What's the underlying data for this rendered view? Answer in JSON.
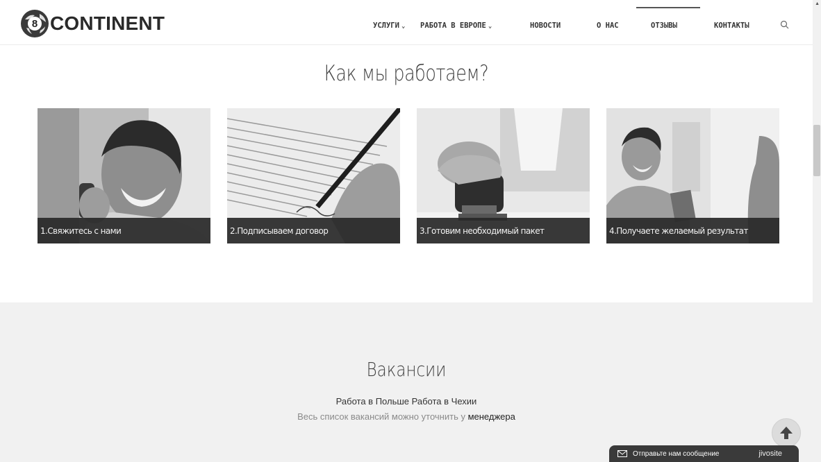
{
  "header": {
    "logo_digit": "8",
    "logo_text": "CONTINENT",
    "nav": [
      {
        "label": "УСЛУГИ",
        "dropdown": true
      },
      {
        "label": "РАБОТА В ЕВРОПЕ",
        "dropdown": true
      },
      {
        "label": "НОВОСТИ",
        "dropdown": false
      },
      {
        "label": "О НАС",
        "dropdown": false
      },
      {
        "label": "ОТЗЫВЫ",
        "dropdown": false,
        "active": true
      },
      {
        "label": "КОНТАКТЫ",
        "dropdown": false
      }
    ],
    "chevron": "⌄"
  },
  "how": {
    "title": "Как мы работаем?",
    "steps": [
      {
        "caption": "1.Свяжитесь с нами",
        "image": "smiling man on phone"
      },
      {
        "caption": "2.Подписываем договор",
        "image": "hand signing document"
      },
      {
        "caption": "3.Готовим необходимый пакет",
        "image": "hand with stamp"
      },
      {
        "caption": "4.Получаете желаемый результат",
        "image": "smiling man with passport"
      }
    ]
  },
  "vacancies": {
    "title": "Вакансии",
    "link_poland": "Работа в Польше",
    "link_czech": "Работа в Чехии",
    "note_prefix": "Весь список вакансий можно уточнить у ",
    "note_link": "менеджера"
  },
  "chat": {
    "text": "Отправьте нам сообщение",
    "brand": "jivosite"
  },
  "colors": {
    "accent_dark": "#333333",
    "section_bg": "#f1f1f1",
    "caption_bg": "#282828"
  }
}
